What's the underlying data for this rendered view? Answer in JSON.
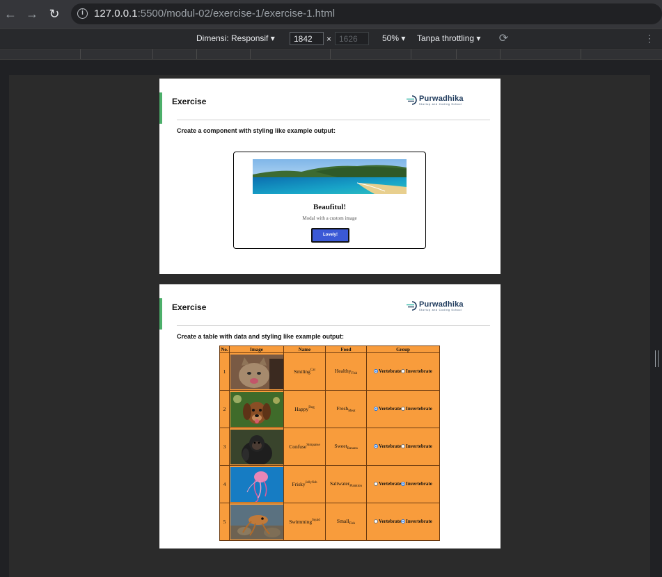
{
  "browser": {
    "url_host": "127.0.0.1",
    "url_rest": ":5500/modul-02/exercise-1/exercise-1.html",
    "info_icon": "info-icon",
    "back_icon": "arrow-left-icon",
    "forward_icon": "arrow-right-icon",
    "reload_icon": "reload-icon"
  },
  "devtools": {
    "dimensions_label": "Dimensi: Responsif ▾",
    "width_value": "1842",
    "height_value": "1626",
    "times": "×",
    "zoom": "50% ▾",
    "throttling": "Tanpa throttling ▾"
  },
  "card1": {
    "title": "Exercise",
    "logo_text": "Purwadhika",
    "logo_tagline": "Startup and Coding School",
    "instruction": "Create a component with styling like example output:",
    "modal": {
      "title": "Beaufitul!",
      "subtitle": "Modal with a custom image",
      "button": "Lovely!"
    }
  },
  "card2": {
    "title": "Exercise",
    "logo_text": "Purwadhika",
    "logo_tagline": "Startup and Coding School",
    "instruction": "Create a table with data and styling like example output:",
    "table": {
      "headers": [
        "No.",
        "Image",
        "Name",
        "Food",
        "Group"
      ],
      "group_options": [
        "Vertebrate",
        "Invertebrate"
      ],
      "rows": [
        {
          "no": "1",
          "image": "cat",
          "name": "Smiling",
          "name_sup": "Cat",
          "food": "Healthy",
          "food_sub": "Fish",
          "group": "Vertebrate"
        },
        {
          "no": "2",
          "image": "dog",
          "name": "Happy",
          "name_sup": "Dog",
          "food": "Fresh",
          "food_sub": "Meat",
          "group": "Vertebrate"
        },
        {
          "no": "3",
          "image": "chimpanzee",
          "name": "Confuse",
          "name_sup": "Simpanse",
          "food": "Sweet",
          "food_sub": "Banana",
          "group": "Vertebrate"
        },
        {
          "no": "4",
          "image": "jellyfish",
          "name": "Frisky",
          "name_sup": "Jellyfish",
          "food": "Saltwater",
          "food_sub": "Plankton",
          "group": "Invertebrate"
        },
        {
          "no": "5",
          "image": "squid",
          "name": "Swimming",
          "name_sup": "Squid",
          "food": "Small",
          "food_sub": "Fish",
          "group": "Invertebrate"
        }
      ]
    }
  },
  "colors": {
    "accent_green": "#4caf6a",
    "table_orange": "#f89c3c",
    "button_blue": "#3b59d6"
  }
}
